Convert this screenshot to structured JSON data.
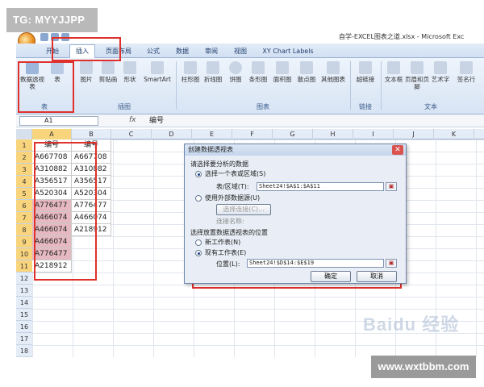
{
  "watermark_top": "TG: MYYJJPP",
  "watermark_bottom": "www.wxtbbm.com",
  "watermark_baidu": "Baidu 经验",
  "window": {
    "title": "自学-EXCEL图表之道.xlsx - Microsoft Exc"
  },
  "ribbon": {
    "tabs": [
      "开始",
      "插入",
      "页面布局",
      "公式",
      "数据",
      "审阅",
      "视图",
      "XY Chart Labels"
    ],
    "active_tab": "插入",
    "groups": {
      "table": {
        "label": "表",
        "buttons": [
          "数据透视表",
          "表"
        ]
      },
      "illustrations": {
        "label": "插图",
        "buttons": [
          "图片",
          "剪贴画",
          "形状",
          "SmartArt"
        ]
      },
      "charts": {
        "label": "图表",
        "buttons": [
          "柱形图",
          "折线图",
          "饼图",
          "条形图",
          "面积图",
          "散点图",
          "其他图表"
        ]
      },
      "links": {
        "label": "链接",
        "buttons": [
          "超链接"
        ]
      },
      "text": {
        "label": "文本",
        "buttons": [
          "文本框",
          "页眉和页脚",
          "艺术字",
          "签名行"
        ]
      }
    }
  },
  "formula_bar": {
    "name_box": "A1",
    "fx": "fx",
    "value": "编号"
  },
  "columns": [
    "A",
    "B",
    "C",
    "D",
    "E",
    "F",
    "G",
    "H",
    "I",
    "J",
    "K"
  ],
  "rows": [
    "1",
    "2",
    "3",
    "4",
    "5",
    "6",
    "7",
    "8",
    "9",
    "10",
    "11",
    "12",
    "13",
    "14",
    "15",
    "16",
    "17",
    "18"
  ],
  "sheet": {
    "col_a": [
      "编号",
      "A667708",
      "A310882",
      "A356517",
      "A520304",
      "A776477",
      "A466074",
      "A466074",
      "A466074",
      "A776477",
      "A218912"
    ],
    "col_b": [
      "编号",
      "A667708",
      "A310882",
      "A356517",
      "A520304",
      "A776477",
      "A466074",
      "A218912"
    ],
    "highlighted_rows": [
      5,
      6,
      7,
      8,
      9
    ]
  },
  "dialog": {
    "title": "创建数据透视表",
    "section1": "请选择要分析的数据",
    "opt_select_range": "选择一个表或区域(S)",
    "range_label": "表/区域(T):",
    "range_value": "Sheet24!$A$1:$A$11",
    "opt_external": "使用外部数据源(U)",
    "choose_conn": "选择连接(C)...",
    "conn_name": "连接名称:",
    "section2": "选择放置数据透视表的位置",
    "opt_new_sheet": "新工作表(N)",
    "opt_existing": "现有工作表(E)",
    "location_label": "位置(L):",
    "location_value": "Sheet24!$D$14:$E$19",
    "ok": "确定",
    "cancel": "取消"
  },
  "colors": {
    "highlight_pink": "#e6b9c2",
    "annotation_red": "#e0302c",
    "selected_header": "#f8d47c"
  }
}
